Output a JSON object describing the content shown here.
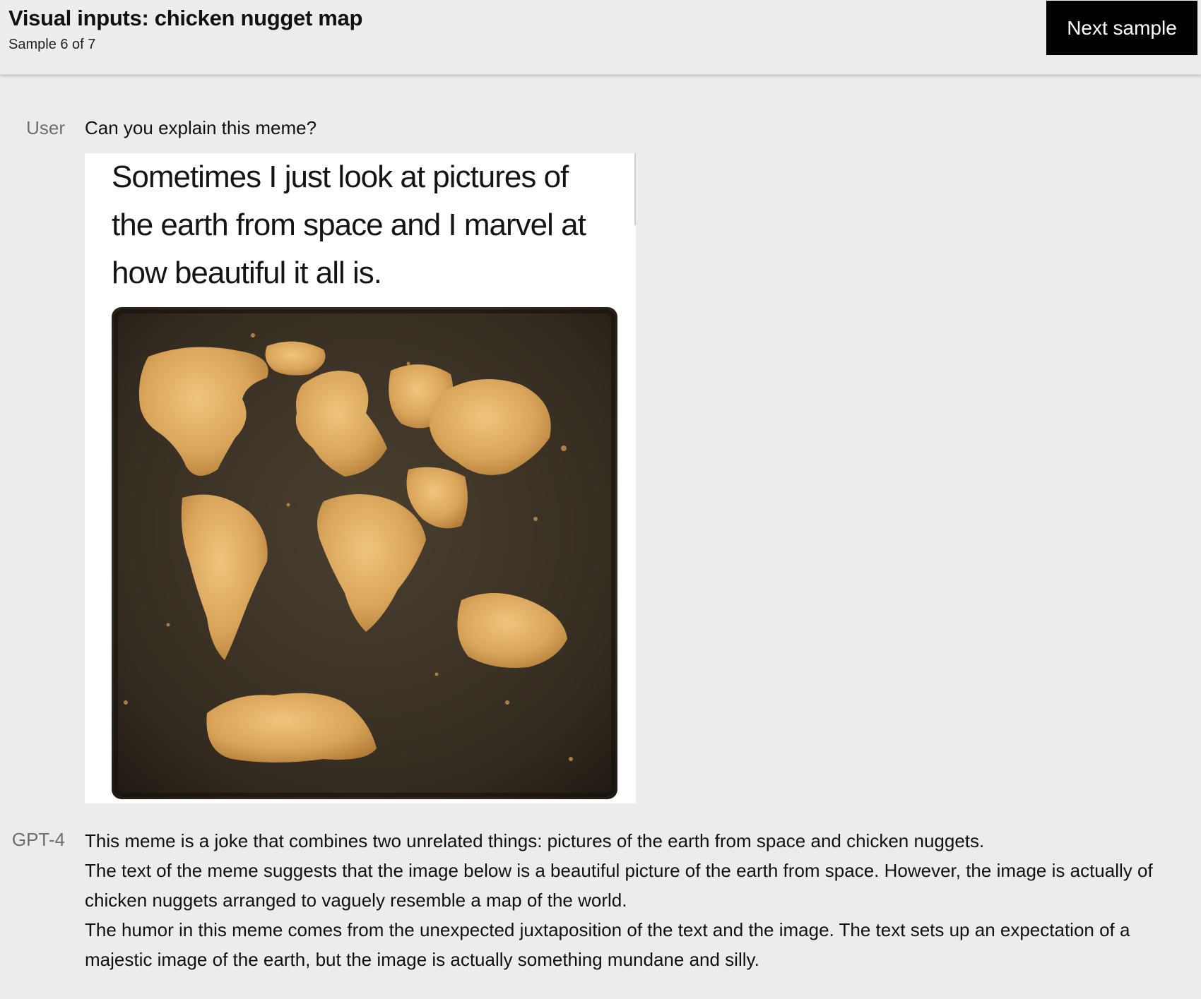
{
  "header": {
    "title": "Visual inputs: chicken nugget map",
    "subtitle": "Sample 6 of 7",
    "next_button": "Next sample"
  },
  "conversation": {
    "user": {
      "role_label": "User",
      "message": "Can you explain this meme?",
      "image": {
        "caption_lines": [
          "Sometimes I just look at pictures of",
          "the earth from space and I marvel at",
          "how beautiful it all is."
        ],
        "content": "chicken nuggets on a dark baking tray arranged like a world map"
      }
    },
    "assistant": {
      "role_label": "GPT-4",
      "paragraphs": [
        "This meme is a joke that combines two unrelated things: pictures of the earth from space and chicken nuggets.",
        "The text of the meme suggests that the image below is a beautiful picture of the earth from space. However, the image is actually of chicken nuggets arranged to vaguely resemble a map of the world.",
        "The humor in this meme comes from the unexpected juxtaposition of the text and the image. The text sets up an expectation of a majestic image of the earth, but the image is actually something mundane and silly."
      ]
    }
  },
  "colors": {
    "page_background": "#ececec",
    "button_background": "#000000",
    "button_text": "#ffffff",
    "role_label": "#6f6f6f",
    "tray": "#3b3226",
    "nugget": "#d9a45a"
  }
}
